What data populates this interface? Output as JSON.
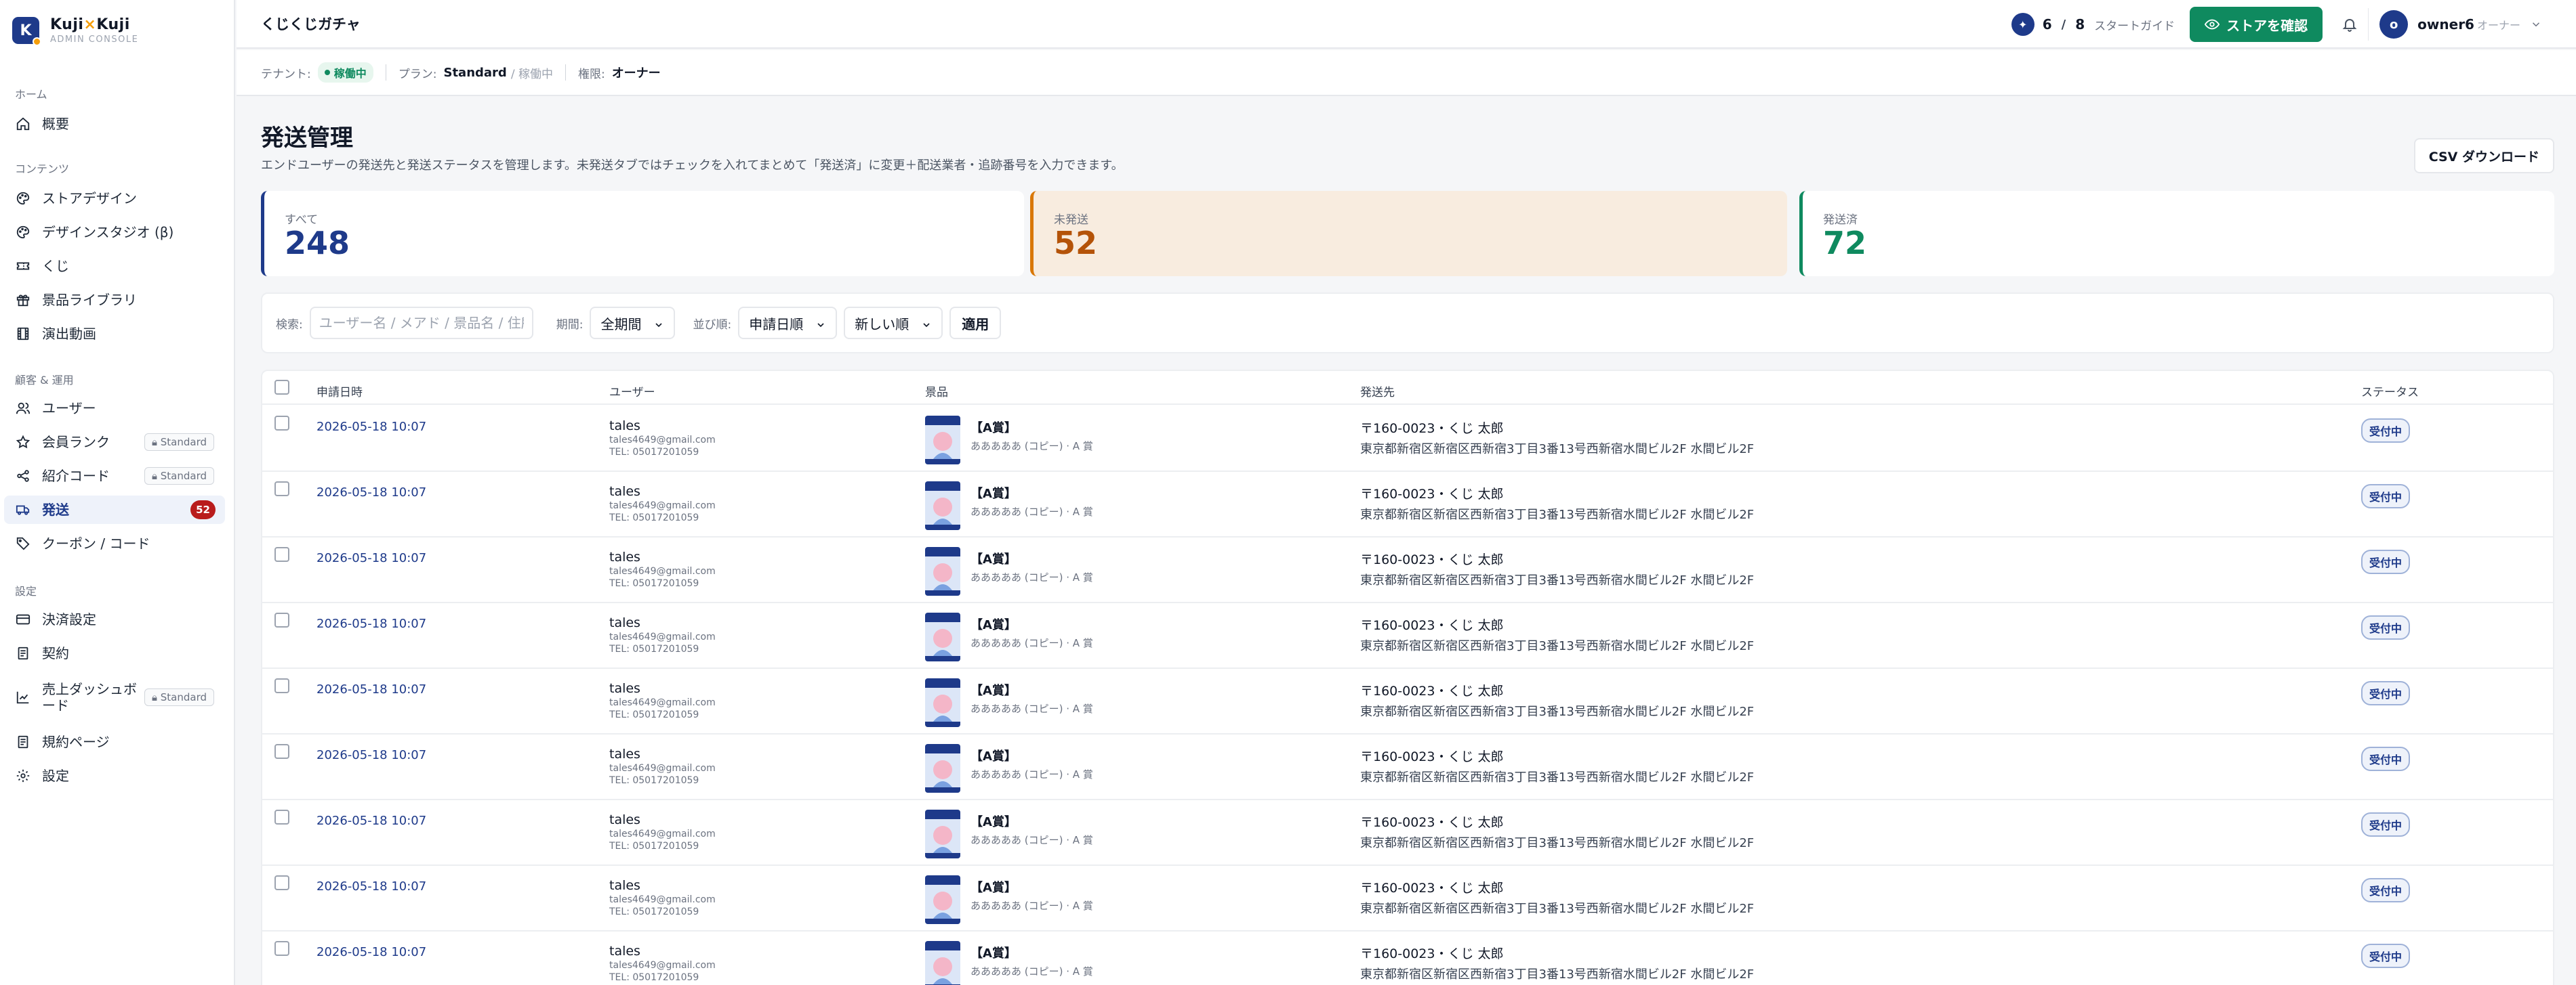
{
  "brand": {
    "name_a": "Kuji",
    "name_x": "×",
    "name_b": "Kuji",
    "sub": "ADMIN CONSOLE",
    "logo_letter": "K",
    "color": "#1e3a8a"
  },
  "sidebar": {
    "groups": [
      {
        "label": "ホーム"
      },
      {
        "label": "コンテンツ"
      },
      {
        "label": "顧客 & 運用"
      },
      {
        "label": "設定"
      }
    ],
    "items": [
      {
        "label": "概要",
        "icon": "home-icon"
      },
      {
        "label": "ストアデザイン",
        "icon": "palette-icon"
      },
      {
        "label": "デザインスタジオ (β)",
        "icon": "palette-icon"
      },
      {
        "label": "くじ",
        "icon": "ticket-icon"
      },
      {
        "label": "景品ライブラリ",
        "icon": "gift-icon"
      },
      {
        "label": "演出動画",
        "icon": "film-icon"
      },
      {
        "label": "ユーザー",
        "icon": "users-icon"
      },
      {
        "label": "会員ランク",
        "icon": "star-icon",
        "tag": "Standard"
      },
      {
        "label": "紹介コード",
        "icon": "share-icon",
        "tag": "Standard"
      },
      {
        "label": "発送",
        "icon": "truck-icon",
        "badge": "52",
        "active": true
      },
      {
        "label": "クーポン / コード",
        "icon": "tag-icon"
      },
      {
        "label": "決済設定",
        "icon": "card-icon"
      },
      {
        "label": "契約",
        "icon": "document-icon"
      },
      {
        "label": "売上ダッシュボード",
        "icon": "chart-icon",
        "tag": "Standard"
      },
      {
        "label": "規約ページ",
        "icon": "document-icon"
      },
      {
        "label": "設定",
        "icon": "gear-icon"
      }
    ]
  },
  "topbar": {
    "store_name": "くじくじガチャ",
    "guide_done": "6",
    "guide_total": "8",
    "guide_label": "スタートガイド",
    "store_button": "ストアを確認",
    "avatar_letter": "o",
    "user_name": "owner6",
    "user_role": "オーナー"
  },
  "tenant": {
    "tenant_label": "テナント:",
    "tenant_status": "稼働中",
    "plan_label": "プラン:",
    "plan_name": "Standard",
    "plan_status": "/ 稼働中",
    "role_label": "権限:",
    "role_name": "オーナー"
  },
  "main": {
    "title": "発送管理",
    "description": "エンドユーザーの発送先と発送ステータスを管理します。未発送タブではチェックを入れてまとめて「発送済」に変更＋配送業者・追跡番号を入力できます。",
    "csv_button": "CSV ダウンロード",
    "stats": {
      "all_label": "すべて",
      "all_value": "248",
      "pending_label": "未発送",
      "pending_value": "52",
      "shipped_label": "発送済",
      "shipped_value": "72"
    },
    "filter": {
      "search_label": "検索:",
      "search_placeholder": "ユーザー名 / メアド / 景品名 / 住所",
      "period_label": "期間:",
      "period_value": "全期間",
      "sort_label": "並び順:",
      "sort_value": "申請日順",
      "order_value": "新しい順",
      "apply": "適用"
    },
    "table": {
      "columns": [
        "申請日時",
        "ユーザー",
        "景品",
        "発送先",
        "ステータス"
      ],
      "rows": [
        {
          "date": "2026-05-18 10:07",
          "user": "tales",
          "email": "tales4649@gmail.com",
          "tel": "TEL: 05017201059",
          "prize": "【A賞】",
          "prize_sub": "あああああ (コピー) · A 賞",
          "ship1": "〒160-0023・くじ 太郎",
          "ship2": "東京都新宿区新宿区西新宿3丁目3番13号西新宿水間ビル2F 水間ビル2F",
          "status": "受付中"
        },
        {
          "date": "2026-05-18 10:07",
          "user": "tales",
          "email": "tales4649@gmail.com",
          "tel": "TEL: 05017201059",
          "prize": "【A賞】",
          "prize_sub": "あああああ (コピー) · A 賞",
          "ship1": "〒160-0023・くじ 太郎",
          "ship2": "東京都新宿区新宿区西新宿3丁目3番13号西新宿水間ビル2F 水間ビル2F",
          "status": "受付中"
        },
        {
          "date": "2026-05-18 10:07",
          "user": "tales",
          "email": "tales4649@gmail.com",
          "tel": "TEL: 05017201059",
          "prize": "【A賞】",
          "prize_sub": "あああああ (コピー) · A 賞",
          "ship1": "〒160-0023・くじ 太郎",
          "ship2": "東京都新宿区新宿区西新宿3丁目3番13号西新宿水間ビル2F 水間ビル2F",
          "status": "受付中"
        },
        {
          "date": "2026-05-18 10:07",
          "user": "tales",
          "email": "tales4649@gmail.com",
          "tel": "TEL: 05017201059",
          "prize": "【A賞】",
          "prize_sub": "あああああ (コピー) · A 賞",
          "ship1": "〒160-0023・くじ 太郎",
          "ship2": "東京都新宿区新宿区西新宿3丁目3番13号西新宿水間ビル2F 水間ビル2F",
          "status": "受付中"
        },
        {
          "date": "2026-05-18 10:07",
          "user": "tales",
          "email": "tales4649@gmail.com",
          "tel": "TEL: 05017201059",
          "prize": "【A賞】",
          "prize_sub": "あああああ (コピー) · A 賞",
          "ship1": "〒160-0023・くじ 太郎",
          "ship2": "東京都新宿区新宿区西新宿3丁目3番13号西新宿水間ビル2F 水間ビル2F",
          "status": "受付中"
        },
        {
          "date": "2026-05-18 10:07",
          "user": "tales",
          "email": "tales4649@gmail.com",
          "tel": "TEL: 05017201059",
          "prize": "【A賞】",
          "prize_sub": "あああああ (コピー) · A 賞",
          "ship1": "〒160-0023・くじ 太郎",
          "ship2": "東京都新宿区新宿区西新宿3丁目3番13号西新宿水間ビル2F 水間ビル2F",
          "status": "受付中"
        },
        {
          "date": "2026-05-18 10:07",
          "user": "tales",
          "email": "tales4649@gmail.com",
          "tel": "TEL: 05017201059",
          "prize": "【A賞】",
          "prize_sub": "あああああ (コピー) · A 賞",
          "ship1": "〒160-0023・くじ 太郎",
          "ship2": "東京都新宿区新宿区西新宿3丁目3番13号西新宿水間ビル2F 水間ビル2F",
          "status": "受付中"
        },
        {
          "date": "2026-05-18 10:07",
          "user": "tales",
          "email": "tales4649@gmail.com",
          "tel": "TEL: 05017201059",
          "prize": "【A賞】",
          "prize_sub": "あああああ (コピー) · A 賞",
          "ship1": "〒160-0023・くじ 太郎",
          "ship2": "東京都新宿区新宿区西新宿3丁目3番13号西新宿水間ビル2F 水間ビル2F",
          "status": "受付中"
        },
        {
          "date": "2026-05-18 10:07",
          "user": "tales",
          "email": "tales4649@gmail.com",
          "tel": "TEL: 05017201059",
          "prize": "【A賞】",
          "prize_sub": "あああああ (コピー) · A 賞",
          "ship1": "〒160-0023・くじ 太郎",
          "ship2": "東京都新宿区新宿区西新宿3丁目3番13号西新宿水間ビル2F 水間ビル2F",
          "status": "受付中"
        }
      ]
    }
  },
  "colors": {
    "accent": "#1e3a8a",
    "success": "#0f8a5f",
    "warning": "#d97706",
    "danger": "#b91c1c"
  }
}
